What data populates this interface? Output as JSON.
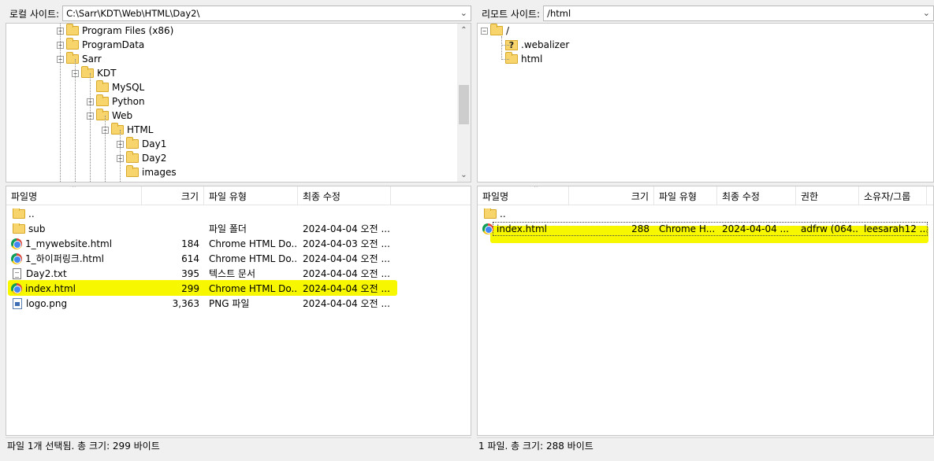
{
  "local": {
    "path_label": "로컬 사이트:",
    "path_value": "C:\\Sarr\\KDT\\Web\\HTML\\Day2\\",
    "tree": [
      {
        "label": "Program Files (x86)",
        "level": 0,
        "exp": "+"
      },
      {
        "label": "ProgramData",
        "level": 0,
        "exp": "+"
      },
      {
        "label": "Sarr",
        "level": 0,
        "exp": "-"
      },
      {
        "label": "KDT",
        "level": 1,
        "exp": "-"
      },
      {
        "label": "MySQL",
        "level": 2,
        "exp": ""
      },
      {
        "label": "Python",
        "level": 2,
        "exp": "+"
      },
      {
        "label": "Web",
        "level": 2,
        "exp": "-"
      },
      {
        "label": "HTML",
        "level": 3,
        "exp": "-"
      },
      {
        "label": "Day1",
        "level": 4,
        "exp": "+"
      },
      {
        "label": "Day2",
        "level": 4,
        "exp": "+"
      },
      {
        "label": "images",
        "level": 4,
        "exp": ""
      }
    ],
    "columns": {
      "name": "파일명",
      "size": "크기",
      "type": "파일 유형",
      "modified": "최종 수정"
    },
    "files": [
      {
        "icon": "folder",
        "name": "..",
        "size": "",
        "type": "",
        "modified": ""
      },
      {
        "icon": "folder",
        "name": "sub",
        "size": "",
        "type": "파일 폴더",
        "modified": "2024-04-04 오전 ..."
      },
      {
        "icon": "chrome",
        "name": "1_mywebsite.html",
        "size": "184",
        "type": "Chrome HTML Do...",
        "modified": "2024-04-03 오전 ..."
      },
      {
        "icon": "chrome",
        "name": "1_하이퍼링크.html",
        "size": "614",
        "type": "Chrome HTML Do...",
        "modified": "2024-04-04 오전 ..."
      },
      {
        "icon": "txt",
        "name": "Day2.txt",
        "size": "395",
        "type": "텍스트 문서",
        "modified": "2024-04-04 오전 ..."
      },
      {
        "icon": "chrome",
        "name": "index.html",
        "size": "299",
        "type": "Chrome HTML Do...",
        "modified": "2024-04-04 오전 ..."
      },
      {
        "icon": "png",
        "name": "logo.png",
        "size": "3,363",
        "type": "PNG 파일",
        "modified": "2024-04-04 오전 ..."
      }
    ],
    "status": "파일 1개 선택됨. 총 크기: 299 바이트"
  },
  "remote": {
    "path_label": "리모트 사이트:",
    "path_value": "/html",
    "tree": [
      {
        "label": "/",
        "level": 0,
        "exp": "-",
        "icon": "folder"
      },
      {
        "label": ".webalizer",
        "level": 1,
        "exp": "",
        "icon": "qfolder"
      },
      {
        "label": "html",
        "level": 1,
        "exp": "",
        "icon": "folder"
      }
    ],
    "columns": {
      "name": "파일명",
      "size": "크기",
      "type": "파일 유형",
      "modified": "최종 수정",
      "perm": "권한",
      "owner": "소유자/그룹"
    },
    "files": [
      {
        "icon": "folder",
        "name": "..",
        "size": "",
        "type": "",
        "modified": "",
        "perm": "",
        "owner": ""
      },
      {
        "icon": "chrome",
        "name": "index.html",
        "size": "288",
        "type": "Chrome H...",
        "modified": "2024-04-04 ...",
        "perm": "adfrw (064...",
        "owner": "leesarah12 ..."
      }
    ],
    "status": "1 파일. 총 크기: 288 바이트"
  },
  "colors": {
    "highlight": "#f7f700",
    "folder": "#f7d56c"
  }
}
